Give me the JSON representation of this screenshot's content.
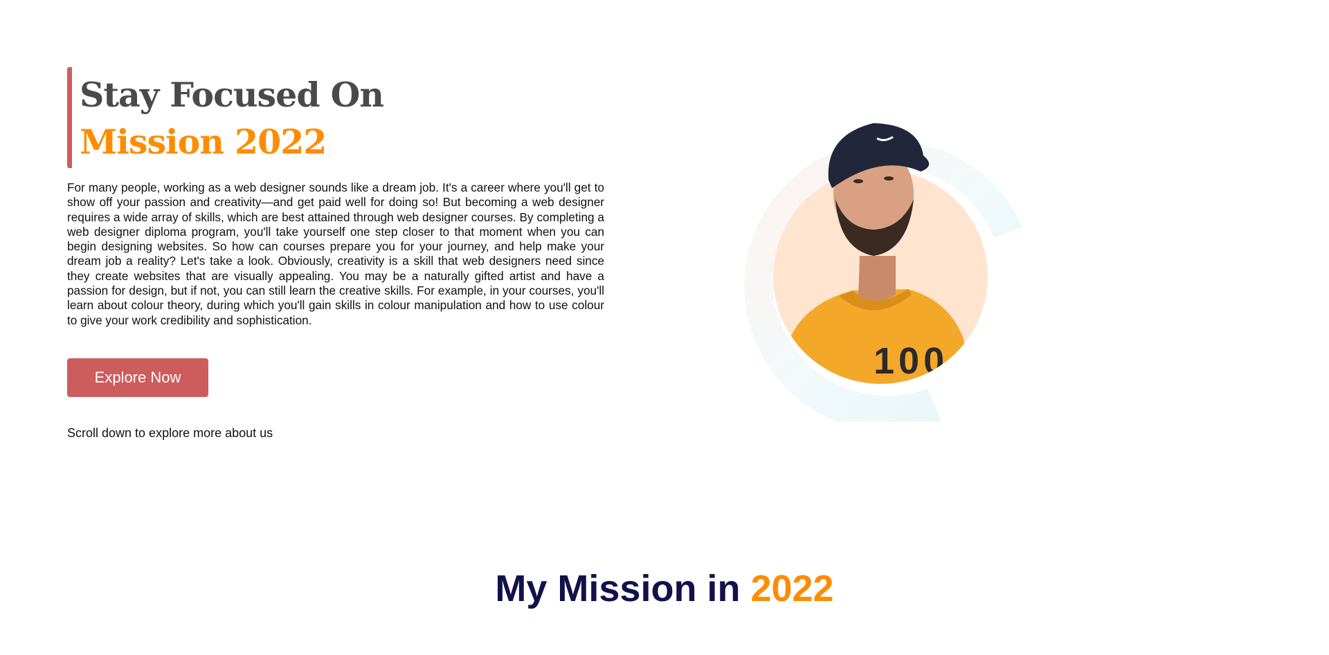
{
  "hero": {
    "heading_line1": "Stay Focused On",
    "heading_line2": "Mission 2022",
    "paragraph": "For many people, working as a web designer sounds like a dream job. It's a career where you'll get to show off your passion and creativity—and get paid well for doing so! But becoming a web designer requires a wide array of skills, which are best attained through web designer courses. By completing a web designer diploma program, you'll take yourself one step closer to that moment when you can begin designing websites. So how can courses prepare you for your journey, and help make your dream job a reality? Let's take a look. Obviously, creativity is a skill that web designers need since they create websites that are visually appealing. You may be a naturally gifted artist and have a passion for design, but if not, you can still learn the creative skills. For example, in your courses, you'll learn about colour theory, during which you'll gain skills in colour manipulation and how to use colour to give your work credibility and sophistication.",
    "button_label": "Explore Now",
    "scroll_hint": "Scroll down to explore more about us",
    "portrait_icon": "person-portrait-icon",
    "shirt_print": "100"
  },
  "mission": {
    "title_main": "My Mission in",
    "title_accent": "2022"
  },
  "colors": {
    "accent_red": "#cd5c5c",
    "accent_orange": "#ff8c00",
    "heading_gray": "#4a4a4a",
    "navy": "#12124a"
  }
}
